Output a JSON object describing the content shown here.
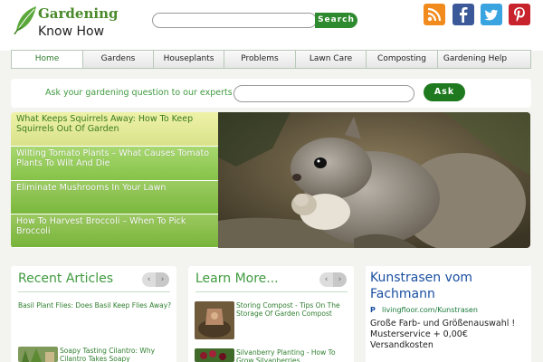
{
  "brand": {
    "name_line1": "Gardening",
    "name_line2": "Know How",
    "accent_color": "#3f9a3f"
  },
  "search": {
    "value": "",
    "button_label": "Search"
  },
  "social_links": [
    {
      "name": "rss-icon",
      "color": "#f28b1e"
    },
    {
      "name": "facebook-icon",
      "color": "#3b5998"
    },
    {
      "name": "twitter-icon",
      "color": "#3aa4e0"
    },
    {
      "name": "pinterest-icon",
      "color": "#c8232c"
    }
  ],
  "nav": {
    "items": [
      {
        "label": "Home",
        "active": true
      },
      {
        "label": "Gardens",
        "active": false
      },
      {
        "label": "Houseplants",
        "active": false
      },
      {
        "label": "Problems",
        "active": false
      },
      {
        "label": "Lawn Care",
        "active": false
      },
      {
        "label": "Composting",
        "active": false
      },
      {
        "label": "Gardening Help",
        "active": false
      }
    ]
  },
  "ask": {
    "prompt": "Ask your gardening question to our experts",
    "value": "",
    "button_label": "Ask"
  },
  "featured": {
    "items": [
      "What Keeps Squirrels Away: How To Keep Squirrels Out Of Garden",
      "Wilting Tomato Plants – What Causes Tomato Plants To Wilt And Die",
      "Eliminate Mushrooms In Your Lawn",
      "How To Harvest Broccoli – When To Pick Broccoli"
    ],
    "photo_subject": "squirrel"
  },
  "recent_articles": {
    "title": "Recent Articles",
    "prev": "‹",
    "next": "›",
    "items": [
      "Basil Plant Flies: Does Basil Keep Flies Away?",
      "Soapy Tasting Cilantro: Why Cilantro Takes Soapy"
    ]
  },
  "learn_more": {
    "title": "Learn More...",
    "prev": "‹",
    "next": "›",
    "items": [
      "Storing Compost - Tips On The Storage Of Garden Compost",
      "Silvanberry Planting - How To Grow Silvanberries"
    ]
  },
  "ad": {
    "title": "Kunstrasen vom Fachmann",
    "url": "livingfloor.com/Kunstrasen",
    "text": "Große Farb- und Größenauswahl ! Musterservice + 0,00€ Versandkosten"
  }
}
